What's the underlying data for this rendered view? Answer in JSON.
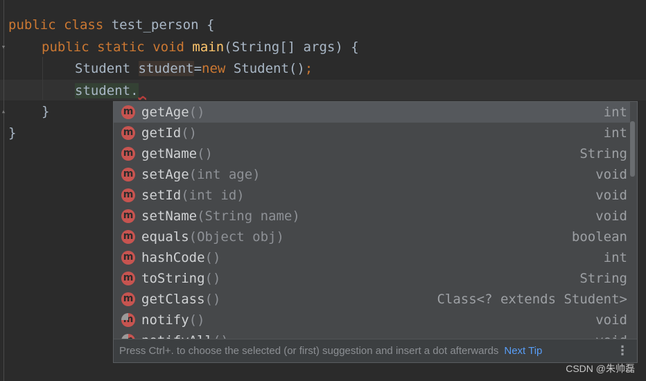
{
  "editor": {
    "line1": {
      "kw1": "public",
      "kw2": "class",
      "rest": " test_person {"
    },
    "line2": {
      "kw1": "public",
      "kw2": "static",
      "kw3": "void",
      "fn": "main",
      "rest": "(String[] args) {"
    },
    "line3": {
      "type": "Student ",
      "var": "student",
      "eq": "=",
      "kw": "new",
      "rest": " Student()",
      "semi": ";"
    },
    "line4": {
      "text": "student.",
      "marker": "_"
    },
    "line5": {
      "text": "}"
    },
    "line6": {
      "text": "}"
    }
  },
  "completion": {
    "items": [
      {
        "name": "getAge",
        "params": "()",
        "ret": "int"
      },
      {
        "name": "getId",
        "params": "()",
        "ret": "int"
      },
      {
        "name": "getName",
        "params": "()",
        "ret": "String"
      },
      {
        "name": "setAge",
        "params": "(int age)",
        "ret": "void"
      },
      {
        "name": "setId",
        "params": "(int id)",
        "ret": "void"
      },
      {
        "name": "setName",
        "params": "(String name)",
        "ret": "void"
      },
      {
        "name": "equals",
        "params": "(Object obj)",
        "ret": "boolean"
      },
      {
        "name": "hashCode",
        "params": "()",
        "ret": "int"
      },
      {
        "name": "toString",
        "params": "()",
        "ret": "String"
      },
      {
        "name": "getClass",
        "params": "()",
        "ret": "Class<? extends Student>"
      },
      {
        "name": "notify",
        "params": "()",
        "ret": "void"
      },
      {
        "name": "notifyAll",
        "params": "()",
        "ret": "void"
      }
    ],
    "icon_letter": "m",
    "footer": {
      "tip": "Press Ctrl+. to choose the selected (or first) suggestion and insert a dot afterwards",
      "next_tip": "Next Tip",
      "more": "⋮"
    }
  },
  "watermark": "CSDN @朱帅磊",
  "colors": {
    "keyword": "#cc7832",
    "method": "#ffc66d",
    "icon": "#c75450",
    "link": "#589df6"
  }
}
